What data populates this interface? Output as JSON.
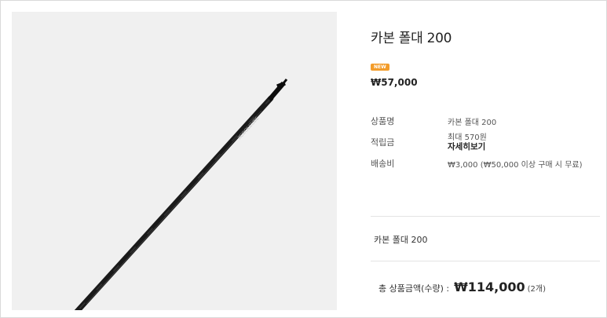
{
  "product": {
    "title": "카본 폴대 200",
    "badge": "NEW",
    "price": "₩57,000",
    "image_alt": "carbon-pole-image",
    "pole_print": "XCOOLCUBE"
  },
  "details": {
    "name_label": "상품명",
    "name_value": "카본 폴대 200",
    "points_label": "적립금",
    "points_value": "최대 570원",
    "points_link": "자세히보기",
    "shipping_label": "배송비",
    "shipping_value": "₩3,000 (₩50,000 이상 구매 시 무료)"
  },
  "selected_option": {
    "name": "카본 폴대 200"
  },
  "total": {
    "label": "총 상품금액(수량) :",
    "amount": "₩114,000",
    "count": "(2개)"
  },
  "colors": {
    "badge": "#f39c2a",
    "image_bg": "#f0f0f0"
  }
}
